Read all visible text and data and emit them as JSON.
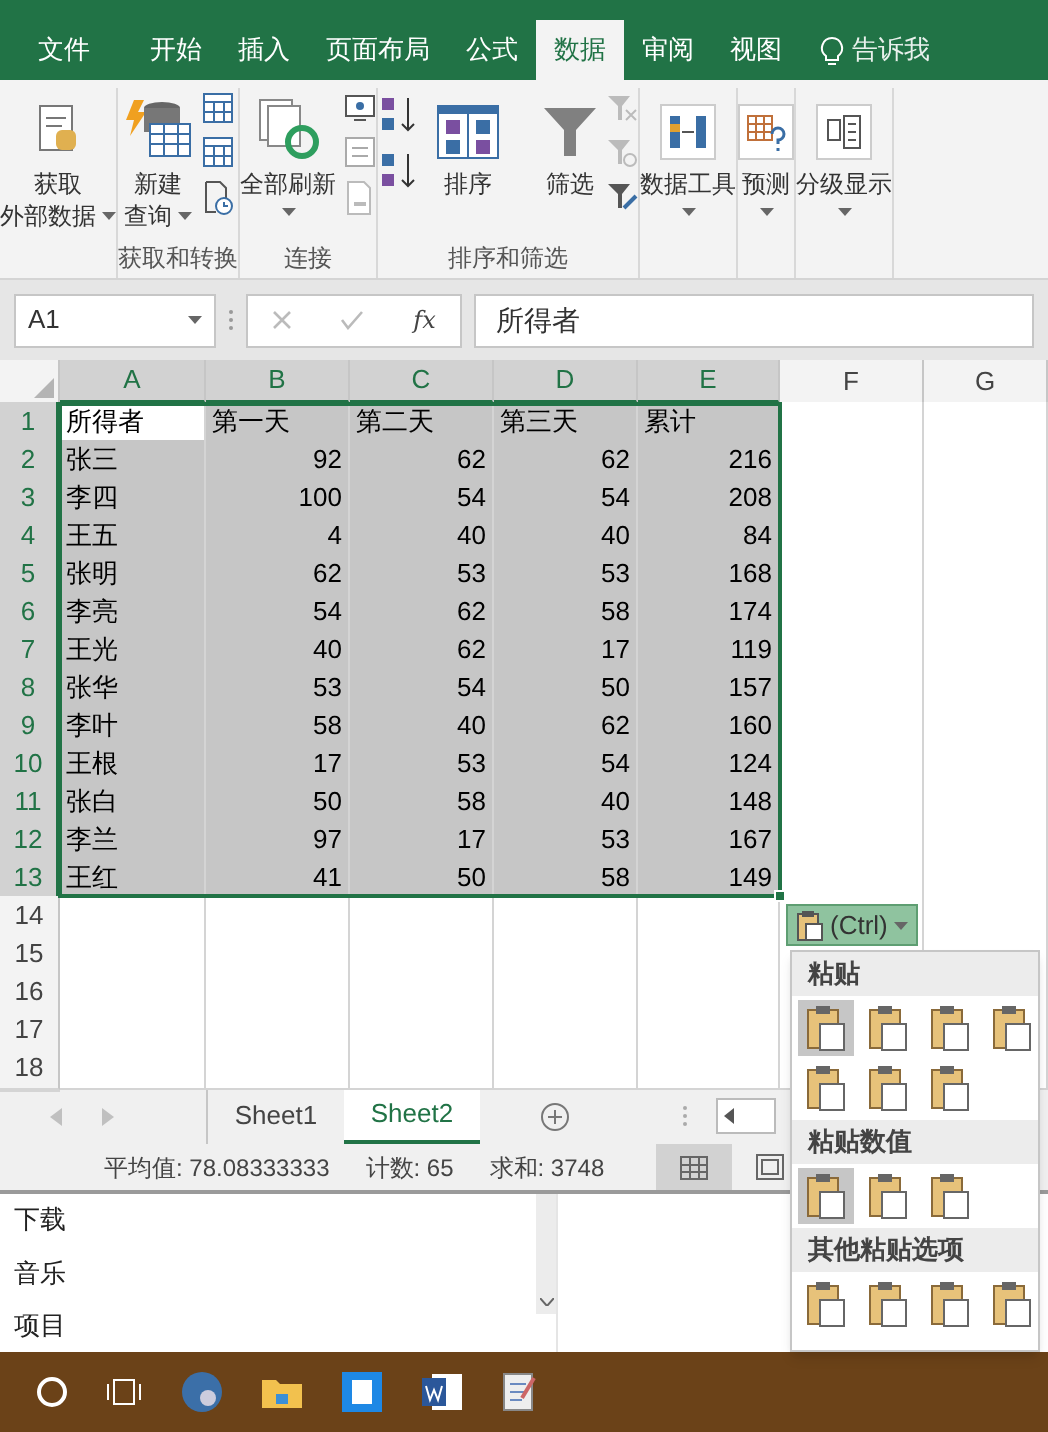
{
  "ribbon_tabs": [
    {
      "label": "文件",
      "selected": false
    },
    {
      "label": "开始",
      "selected": false
    },
    {
      "label": "插入",
      "selected": false
    },
    {
      "label": "页面布局",
      "selected": false
    },
    {
      "label": "公式",
      "selected": false
    },
    {
      "label": "数据",
      "selected": true
    },
    {
      "label": "审阅",
      "selected": false
    },
    {
      "label": "视图",
      "selected": false
    }
  ],
  "tell_me": "告诉我",
  "ribbon": {
    "get_external_data": [
      "获取",
      "外部数据"
    ],
    "new_query": [
      "新建",
      "查询"
    ],
    "refresh_all": "全部刷新",
    "sort": "排序",
    "filter": "筛选",
    "data_tools": "数据工具",
    "forecast": "预测",
    "outline": "分级显示",
    "group_labels": [
      "获取和转换",
      "连接",
      "排序和筛选"
    ]
  },
  "formula_bar": {
    "name_box": "A1",
    "fx": "fx",
    "value": "所得者"
  },
  "columns": [
    {
      "label": "A",
      "selected": true
    },
    {
      "label": "B",
      "selected": true
    },
    {
      "label": "C",
      "selected": true
    },
    {
      "label": "D",
      "selected": true
    },
    {
      "label": "E",
      "selected": true
    },
    {
      "label": "F",
      "selected": false
    },
    {
      "label": "G",
      "selected": false
    }
  ],
  "rows": [
    {
      "number": "1",
      "selected": true,
      "cells": [
        {
          "text": "所得者",
          "kind": "text"
        },
        {
          "text": "第一天",
          "kind": "text"
        },
        {
          "text": "第二天",
          "kind": "text"
        },
        {
          "text": "第三天",
          "kind": "text"
        },
        {
          "text": "累计",
          "kind": "text"
        }
      ]
    },
    {
      "number": "2",
      "selected": true,
      "cells": [
        {
          "text": "张三",
          "kind": "text"
        },
        {
          "text": "92",
          "kind": "number"
        },
        {
          "text": "62",
          "kind": "number"
        },
        {
          "text": "62",
          "kind": "number"
        },
        {
          "text": "216",
          "kind": "number"
        }
      ]
    },
    {
      "number": "3",
      "selected": true,
      "cells": [
        {
          "text": "李四",
          "kind": "text"
        },
        {
          "text": "100",
          "kind": "number"
        },
        {
          "text": "54",
          "kind": "number"
        },
        {
          "text": "54",
          "kind": "number"
        },
        {
          "text": "208",
          "kind": "number"
        }
      ]
    },
    {
      "number": "4",
      "selected": true,
      "cells": [
        {
          "text": "王五",
          "kind": "text"
        },
        {
          "text": "4",
          "kind": "number"
        },
        {
          "text": "40",
          "kind": "number"
        },
        {
          "text": "40",
          "kind": "number"
        },
        {
          "text": "84",
          "kind": "number"
        }
      ]
    },
    {
      "number": "5",
      "selected": true,
      "cells": [
        {
          "text": "张明",
          "kind": "text"
        },
        {
          "text": "62",
          "kind": "number"
        },
        {
          "text": "53",
          "kind": "number"
        },
        {
          "text": "53",
          "kind": "number"
        },
        {
          "text": "168",
          "kind": "number"
        }
      ]
    },
    {
      "number": "6",
      "selected": true,
      "cells": [
        {
          "text": "李亮",
          "kind": "text"
        },
        {
          "text": "54",
          "kind": "number"
        },
        {
          "text": "62",
          "kind": "number"
        },
        {
          "text": "58",
          "kind": "number"
        },
        {
          "text": "174",
          "kind": "number"
        }
      ]
    },
    {
      "number": "7",
      "selected": true,
      "cells": [
        {
          "text": "王光",
          "kind": "text"
        },
        {
          "text": "40",
          "kind": "number"
        },
        {
          "text": "62",
          "kind": "number"
        },
        {
          "text": "17",
          "kind": "number"
        },
        {
          "text": "119",
          "kind": "number"
        }
      ]
    },
    {
      "number": "8",
      "selected": true,
      "cells": [
        {
          "text": "张华",
          "kind": "text"
        },
        {
          "text": "53",
          "kind": "number"
        },
        {
          "text": "54",
          "kind": "number"
        },
        {
          "text": "50",
          "kind": "number"
        },
        {
          "text": "157",
          "kind": "number"
        }
      ]
    },
    {
      "number": "9",
      "selected": true,
      "cells": [
        {
          "text": "李叶",
          "kind": "text"
        },
        {
          "text": "58",
          "kind": "number"
        },
        {
          "text": "40",
          "kind": "number"
        },
        {
          "text": "62",
          "kind": "number"
        },
        {
          "text": "160",
          "kind": "number"
        }
      ]
    },
    {
      "number": "10",
      "selected": true,
      "cells": [
        {
          "text": "王根",
          "kind": "text"
        },
        {
          "text": "17",
          "kind": "number"
        },
        {
          "text": "53",
          "kind": "number"
        },
        {
          "text": "54",
          "kind": "number"
        },
        {
          "text": "124",
          "kind": "number"
        }
      ]
    },
    {
      "number": "11",
      "selected": true,
      "cells": [
        {
          "text": "张白",
          "kind": "text"
        },
        {
          "text": "50",
          "kind": "number"
        },
        {
          "text": "58",
          "kind": "number"
        },
        {
          "text": "40",
          "kind": "number"
        },
        {
          "text": "148",
          "kind": "number"
        }
      ]
    },
    {
      "number": "12",
      "selected": true,
      "cells": [
        {
          "text": "李兰",
          "kind": "text"
        },
        {
          "text": "97",
          "kind": "number"
        },
        {
          "text": "17",
          "kind": "number"
        },
        {
          "text": "53",
          "kind": "number"
        },
        {
          "text": "167",
          "kind": "number"
        }
      ]
    },
    {
      "number": "13",
      "selected": true,
      "cells": [
        {
          "text": "王红",
          "kind": "text"
        },
        {
          "text": "41",
          "kind": "number"
        },
        {
          "text": "50",
          "kind": "number"
        },
        {
          "text": "58",
          "kind": "number"
        },
        {
          "text": "149",
          "kind": "number"
        }
      ]
    },
    {
      "number": "14",
      "selected": false,
      "cells": []
    },
    {
      "number": "15",
      "selected": false,
      "cells": []
    },
    {
      "number": "16",
      "selected": false,
      "cells": []
    },
    {
      "number": "17",
      "selected": false,
      "cells": []
    },
    {
      "number": "18",
      "selected": false,
      "cells": []
    }
  ],
  "sheet_tabs": [
    {
      "label": "Sheet1",
      "selected": false
    },
    {
      "label": "Sheet2",
      "selected": true
    }
  ],
  "status_bar": [
    "平均值: 78.08333333",
    "计数: 65",
    "求和: 3748"
  ],
  "paste_options": {
    "button": "(Ctrl)",
    "sections": [
      {
        "title": "粘贴",
        "options": [
          {
            "selected": true
          },
          {
            "selected": false
          },
          {
            "selected": false
          },
          {
            "selected": false
          },
          {
            "selected": false
          },
          {
            "selected": false
          },
          {
            "selected": false
          }
        ]
      },
      {
        "title": "粘贴数值",
        "options": [
          {
            "selected": true
          },
          {
            "selected": false
          },
          {
            "selected": false
          }
        ]
      },
      {
        "title": "其他粘贴选项",
        "options": [
          {
            "selected": false
          },
          {
            "selected": false
          },
          {
            "selected": false
          },
          {
            "selected": false
          }
        ]
      }
    ]
  },
  "explorer_items": [
    "下载",
    "音乐",
    "项目"
  ]
}
